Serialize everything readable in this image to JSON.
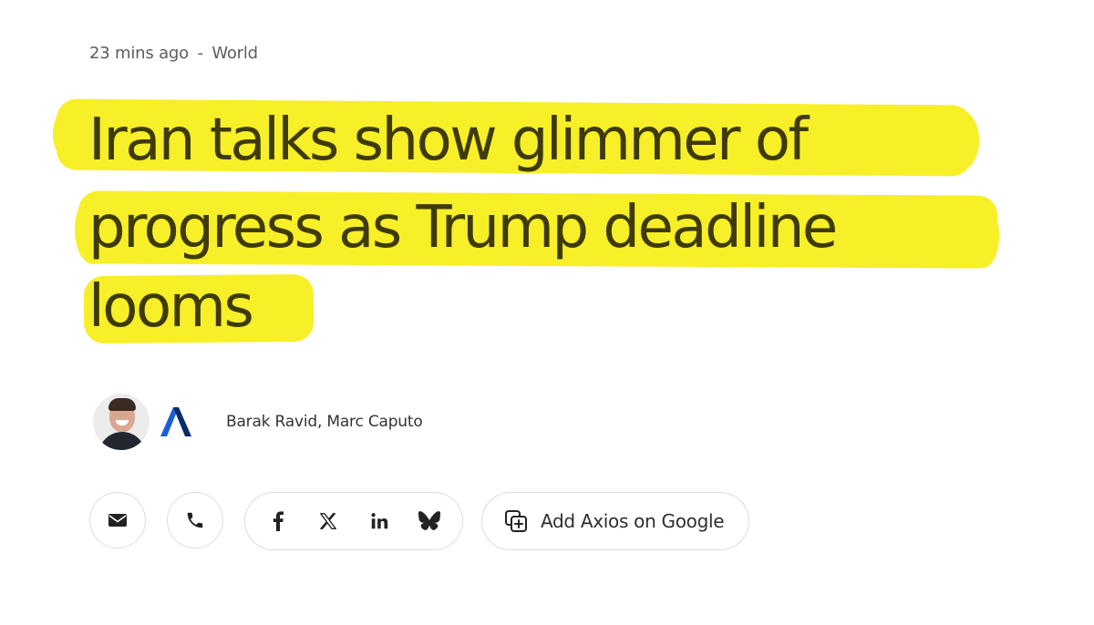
{
  "article": {
    "time_ago": "23 mins ago",
    "separator": "-",
    "section": "World",
    "headline_lines": [
      "Iran talks show glimmer of",
      "progress as Trump deadline",
      "looms"
    ],
    "highlight_color": "#f7ef27",
    "authors": "Barak Ravid, Marc Caputo"
  },
  "actions": {
    "google_button_label": "Add Axios on Google",
    "icons": {
      "email": "envelope-icon",
      "phone": "phone-icon",
      "facebook": "facebook-icon",
      "x": "x-icon",
      "linkedin": "linkedin-icon",
      "bluesky": "bluesky-icon",
      "add_source": "add-source-icon"
    }
  },
  "brand": {
    "logo": "axios-logo",
    "logo_color": "#1a5fd6",
    "logo_dark": "#0b2a6b"
  }
}
